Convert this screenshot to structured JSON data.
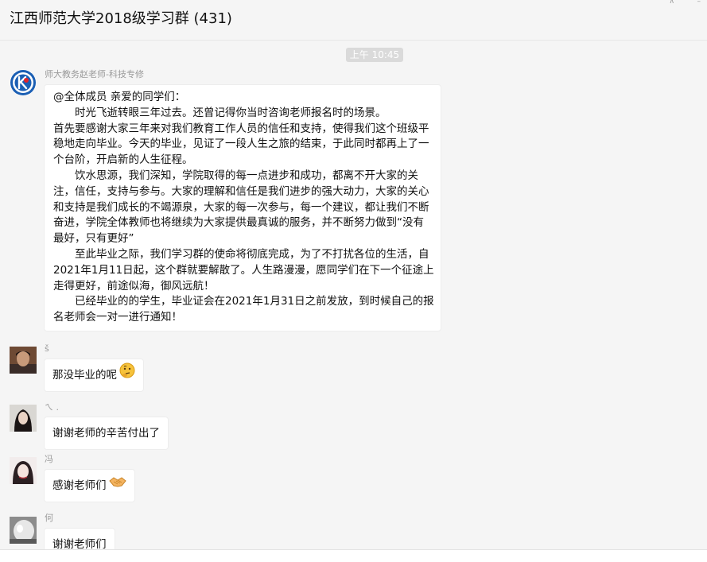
{
  "window": {
    "title": "江西师范大学2018级学习群 (431)",
    "pin_glyph": "⊼",
    "minimize_glyph": "–"
  },
  "chat": {
    "timestamp": "上午 10:45",
    "messages": [
      {
        "sender": "师大教务赵老师-科技专修",
        "avatar": "school-logo",
        "paragraphs": [
          "@全体成员 亲爱的同学们：",
          "　　时光飞逝转眼三年过去。还曾记得你当时咨询老师报名时的场景。",
          "首先要感谢大家三年来对我们教育工作人员的信任和支持，使得我们这个班级平稳地走向毕业。今天的毕业，见证了一段人生之旅的结束，于此同时都再上了一个台阶，开启新的人生征程。",
          "　　饮水思源，我们深知，学院取得的每一点进步和成功，都离不开大家的关注，信任，支持与参与。大家的理解和信任是我们进步的强大动力，大家的关心和支持是我们成长的不竭源泉，大家的每一次参与，每一个建议，都让我们不断奋进，学院全体教师也将继续为大家提供最真诚的服务，并不断努力做到“没有最好，只有更好”",
          "　　至此毕业之际，我们学习群的使命将彻底完成，为了不打扰各位的生活，自2021年1月11日起，这个群就要解散了。人生路漫漫，愿同学们在下一个征途上走得更好，前途似海，御风远航！",
          "　　已经毕业的的学生，毕业证会在2021年1月31日之前发放，到时候自己的报名老师会一对一进行通知！"
        ]
      },
      {
        "sender": "š",
        "text": "那没毕业的呢",
        "emoji": "thinking-face"
      },
      {
        "sender": "ㄟ .",
        "text": "谢谢老师的辛苦付出了",
        "emoji": ""
      },
      {
        "sender": "冯",
        "text": "感谢老师们",
        "emoji": "handshake"
      },
      {
        "sender": "何",
        "text": "谢谢老师们",
        "emoji": ""
      }
    ]
  },
  "colors": {
    "background": "#f5f5f5",
    "bubble": "#ffffff",
    "timestamp_badge": "#dadada",
    "sender_name": "#9a9a9a",
    "logo_blue": "#1b5fb4",
    "logo_red": "#e2242b"
  }
}
